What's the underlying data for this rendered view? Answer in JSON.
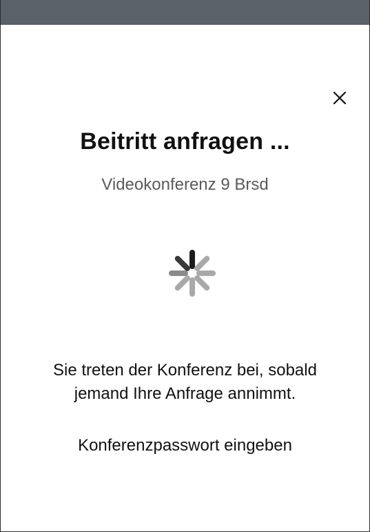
{
  "dialog": {
    "title": "Beitritt anfragen ...",
    "conference_name": "Videokonferenz 9 Brsd",
    "message_line1": "Sie treten der Konferenz bei, sobald",
    "message_line2": "jemand Ihre Anfrage annimmt.",
    "password_link": "Konferenzpasswort eingeben",
    "close_icon": "close-icon",
    "spinner_icon": "loading-spinner-icon"
  },
  "colors": {
    "topbar": "#5b6168",
    "title": "#111111",
    "subtitle": "#5a5a5a",
    "spinner_dark": "#1c1c1c",
    "spinner_light": "#a9a9a9"
  }
}
